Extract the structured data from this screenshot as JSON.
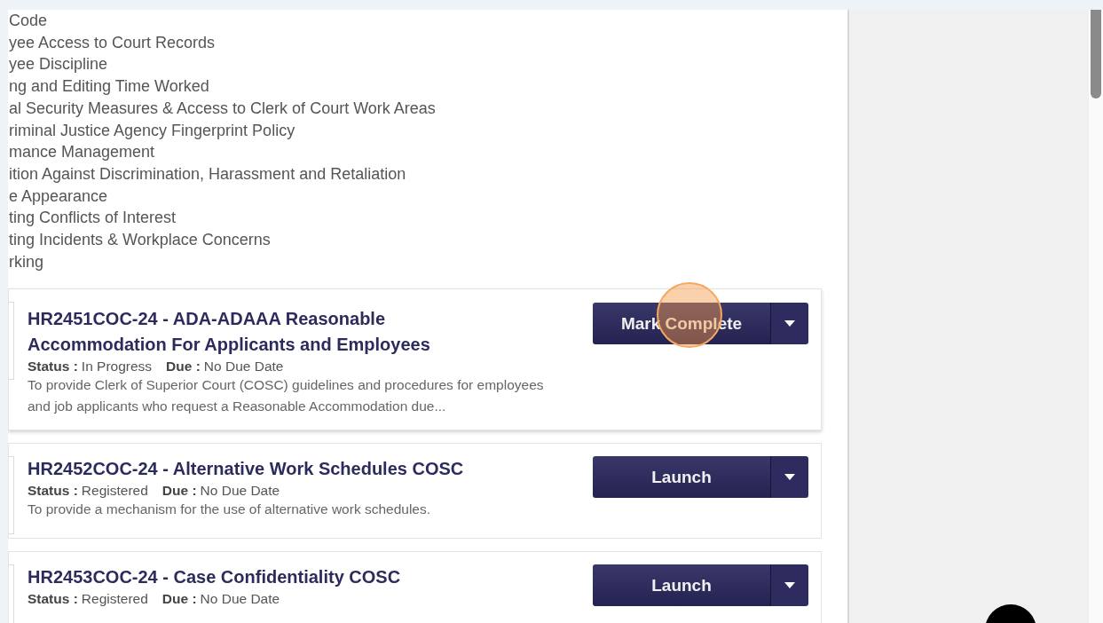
{
  "policy_list": [
    "Code",
    "yee Access to Court Records",
    "yee Discipline",
    "ng and Editing Time Worked",
    "al Security Measures & Access to Clerk of Court Work Areas",
    "riminal Justice Agency Fingerprint Policy",
    "mance Management",
    "ition Against Discrimination, Harassment and Retaliation",
    "e Appearance",
    "ting Conflicts of Interest",
    "ting Incidents & Workplace Concerns",
    "rking"
  ],
  "courses": [
    {
      "title": "HR2451COC-24 - ADA-ADAAA Reasonable Accommodation For Applicants and Employees",
      "status_label": "Status :",
      "status": "In Progress",
      "due_label": "Due :",
      "due": "No Due Date",
      "description": "To provide Clerk of Superior Court (COSC) guidelines and procedures for employees and job applicants who request a Reasonable Accommodation due...",
      "action": "Mark Complete",
      "highlighted": true
    },
    {
      "title": "HR2452COC-24 - Alternative Work Schedules COSC",
      "status_label": "Status :",
      "status": "Registered",
      "due_label": "Due :",
      "due": "No Due Date",
      "description": "To provide a mechanism for the use of alternative work schedules.",
      "action": "Launch",
      "highlighted": false
    },
    {
      "title": "HR2453COC-24 - Case Confidentiality COSC",
      "status_label": "Status :",
      "status": "Registered",
      "due_label": "Due :",
      "due": "No Due Date",
      "action": "Launch",
      "highlighted": false
    }
  ]
}
